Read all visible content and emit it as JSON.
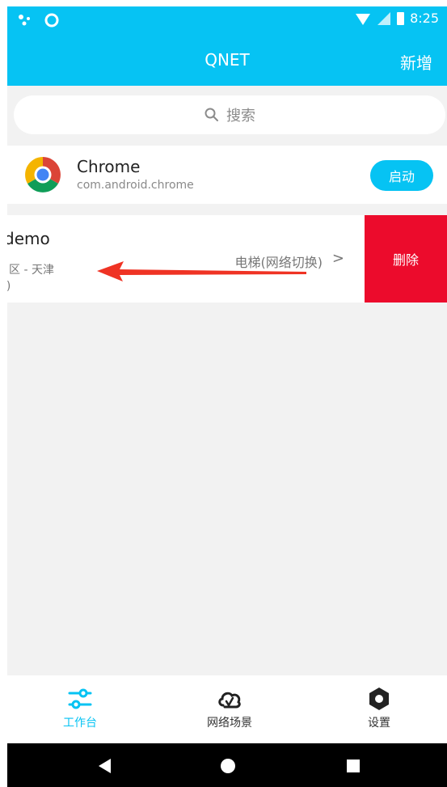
{
  "status": {
    "time": "8:25"
  },
  "header": {
    "title": "QNET",
    "add_label": "新增"
  },
  "search": {
    "placeholder": "搜索"
  },
  "app": {
    "name": "Chrome",
    "package": "com.android.chrome",
    "launch_label": "启动"
  },
  "scene": {
    "title": "‹demo",
    "subtitle": "自区 - 天津",
    "subtitle2": "G)",
    "type": "电梯(网络切换)",
    "delete_label": "删除"
  },
  "tabs": [
    {
      "label": "工作台",
      "icon": "sliders-icon",
      "active": true
    },
    {
      "label": "网络场景",
      "icon": "cloud-icon",
      "active": false
    },
    {
      "label": "设置",
      "icon": "settings-icon",
      "active": false
    }
  ],
  "colors": {
    "primary": "#06c3f3",
    "danger": "#ec0b2c",
    "arrow": "#ef3324",
    "nav": "#000000"
  }
}
